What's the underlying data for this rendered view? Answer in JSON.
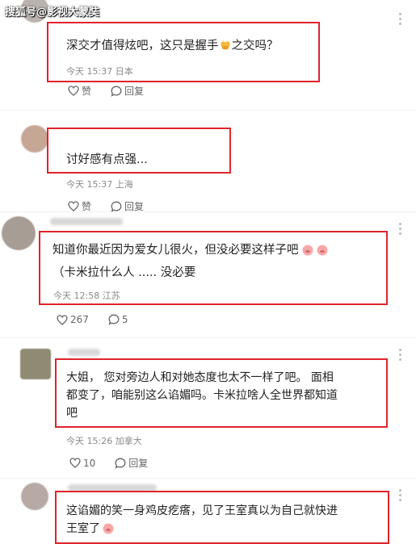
{
  "watermark": "搜狐号@影视大蒙奘",
  "comments": [
    {
      "text_lines": [
        "深交才值得炫吧，这只是握手",
        "之交吗？"
      ],
      "time": "今天 15:37",
      "location": "日本",
      "like_label": "赞",
      "reply_label": "回复"
    },
    {
      "text_lines": [
        "讨好感有点强..."
      ],
      "time": "今天 15:37",
      "location": "上海",
      "like_label": "赞",
      "reply_label": "回复"
    },
    {
      "text_lines": [
        "知道你最近因为爱女儿很火，但没必要这样子吧",
        "（卡米拉什么人 ..... 没必要"
      ],
      "time": "今天 12:58",
      "location": "江苏",
      "like_count": "267",
      "reply_count": "5"
    },
    {
      "text_lines": [
        "大姐， 您对旁边人和对她态度也太不一样了吧。 面相",
        "都变了，咱能别这么谄媚吗。卡米拉啥人全世界都知道",
        "吧"
      ],
      "time": "今天 15:26",
      "location": "加拿大",
      "like_count": "10",
      "reply_label": "回复"
    },
    {
      "text_lines": [
        "这谄媚的笑一身鸡皮疙瘩，见了王室真以为自己就快进",
        "王室了"
      ]
    }
  ],
  "icons": [
    "heart-icon",
    "comment-bubble-icon",
    "heart-hand-emoji",
    "pig-face-emoji"
  ],
  "colors": {
    "highlight_box": "#e0242b",
    "meta_text": "#8a8a8a"
  }
}
